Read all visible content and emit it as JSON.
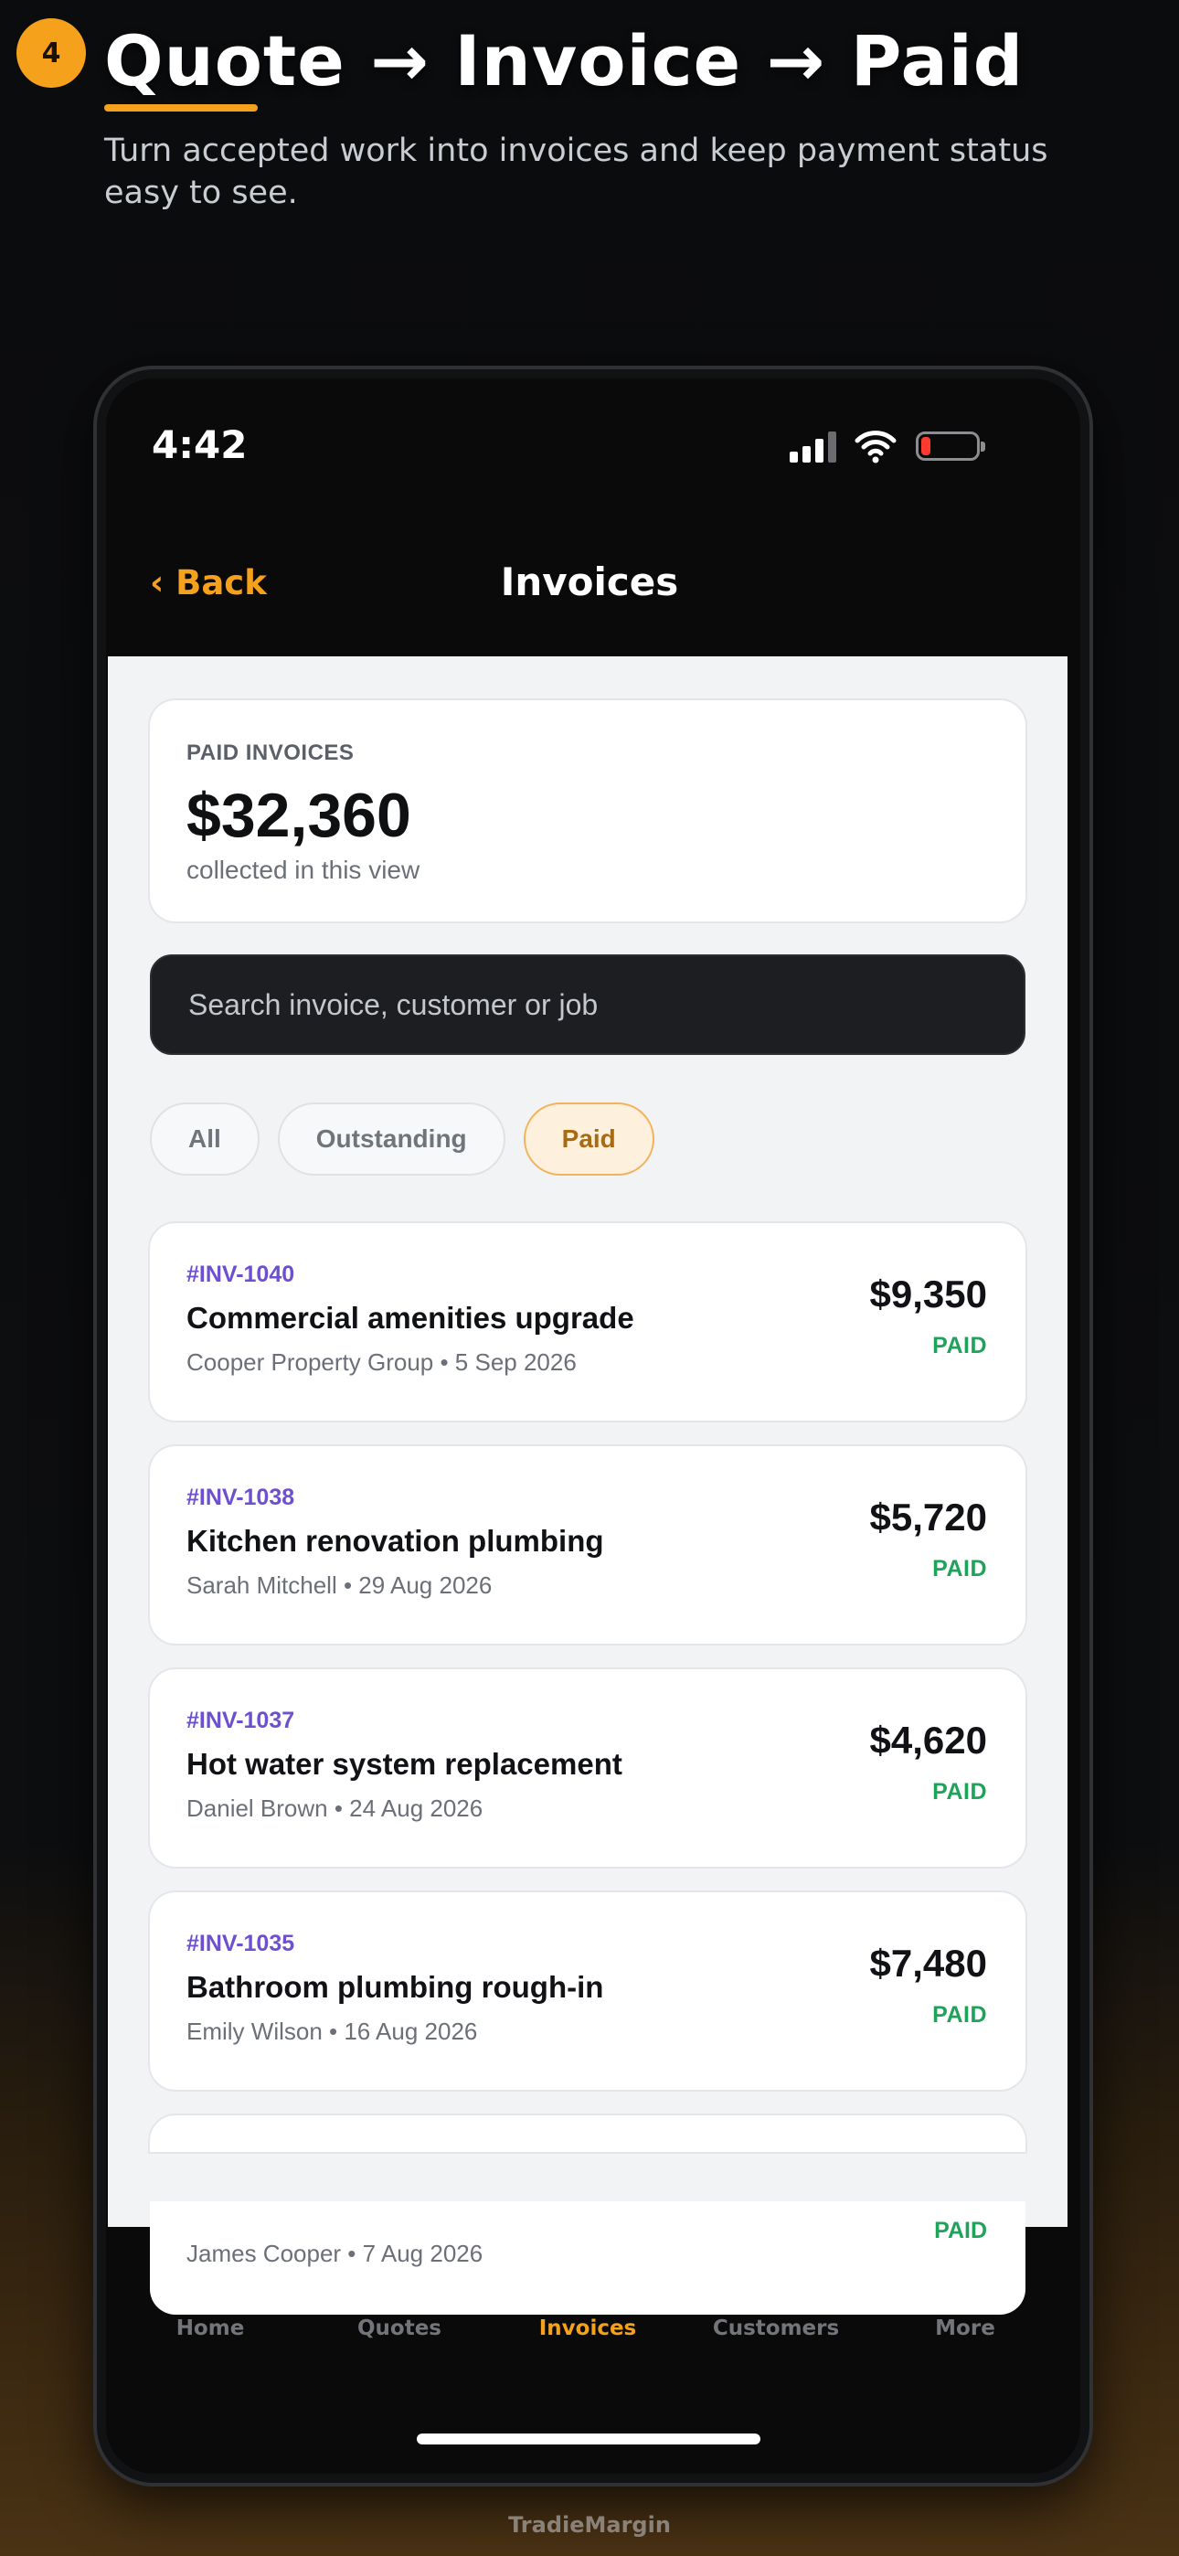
{
  "step": {
    "number": "4"
  },
  "headline": "Quote → Invoice → Paid",
  "subhead": "Turn accepted work into invoices and keep payment status easy to see.",
  "status_bar": {
    "time": "4:42"
  },
  "nav": {
    "back_label": "‹ Back",
    "title": "Invoices"
  },
  "summary": {
    "label": "PAID INVOICES",
    "amount": "$32,360",
    "caption": "collected in this view"
  },
  "search": {
    "placeholder": "Search invoice, customer or job"
  },
  "filters": [
    {
      "label": "All",
      "active": false
    },
    {
      "label": "Outstanding",
      "active": false
    },
    {
      "label": "Paid",
      "active": true
    }
  ],
  "invoices": [
    {
      "number": "#INV-1040",
      "title": "Commercial amenities upgrade",
      "meta": "Cooper Property Group • 5 Sep 2026",
      "amount": "$9,350",
      "status": "PAID"
    },
    {
      "number": "#INV-1038",
      "title": "Kitchen renovation plumbing",
      "meta": "Sarah Mitchell • 29 Aug 2026",
      "amount": "$5,720",
      "status": "PAID"
    },
    {
      "number": "#INV-1037",
      "title": "Hot water system replacement",
      "meta": "Daniel Brown • 24 Aug 2026",
      "amount": "$4,620",
      "status": "PAID"
    },
    {
      "number": "#INV-1035",
      "title": "Bathroom plumbing rough-in",
      "meta": "Emily Wilson • 16 Aug 2026",
      "amount": "$7,480",
      "status": "PAID"
    }
  ],
  "overflow_invoice": {
    "meta": "James Cooper • 7 Aug 2026",
    "status": "PAID"
  },
  "tabs": [
    {
      "label": "Home",
      "active": false
    },
    {
      "label": "Quotes",
      "active": false
    },
    {
      "label": "Invoices",
      "active": true
    },
    {
      "label": "Customers",
      "active": false
    },
    {
      "label": "More",
      "active": false
    }
  ],
  "brand": "TradieMargin",
  "colors": {
    "accent": "#f5a11c",
    "paid": "#1ea35a",
    "invoice_number": "#6d4fd0",
    "battery_low": "#ff3b30"
  }
}
